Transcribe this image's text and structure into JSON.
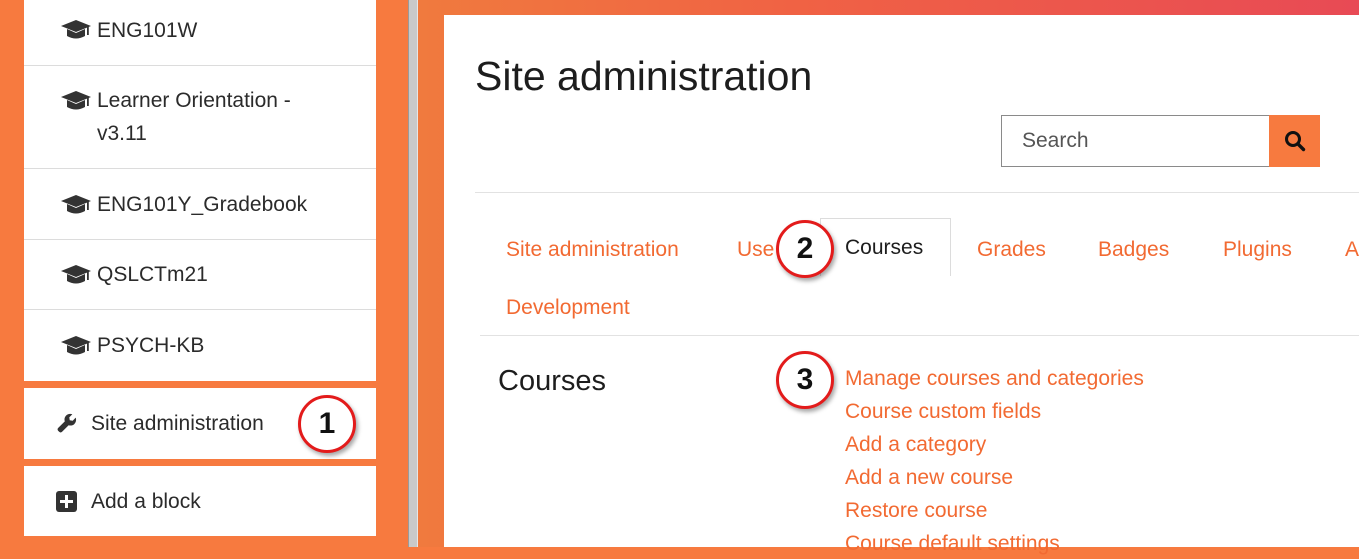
{
  "sidebar": {
    "courses": [
      {
        "label": "ENG101W"
      },
      {
        "label": "Learner Orientation -"
      },
      {
        "label": "v3.11"
      },
      {
        "label": "ENG101Y_Gradebook"
      },
      {
        "label": "QSLCTm21"
      },
      {
        "label": "PSYCH-KB"
      }
    ],
    "site_admin_label": "Site administration",
    "add_block_label": "Add a block"
  },
  "main": {
    "title": "Site administration",
    "search": {
      "placeholder": "Search"
    },
    "tabs": [
      {
        "label": "Site administration"
      },
      {
        "label": "Use"
      },
      {
        "label": "Courses",
        "active": true
      },
      {
        "label": "Grades"
      },
      {
        "label": "Badges"
      },
      {
        "label": "Plugins"
      },
      {
        "label": "A"
      },
      {
        "label": "Development"
      }
    ],
    "section": {
      "title": "Courses",
      "links": [
        {
          "label": "Manage courses and categories"
        },
        {
          "label": "Course custom fields"
        },
        {
          "label": "Add a category"
        },
        {
          "label": "Add a new course"
        },
        {
          "label": "Restore course"
        },
        {
          "label": "Course default settings"
        }
      ]
    }
  },
  "callouts": [
    "1",
    "2",
    "3"
  ],
  "colors": {
    "accent": "#f77a3f",
    "link": "#f26a32",
    "callout_border": "#e31b1b"
  },
  "icons": {
    "course": "graduation-cap-icon",
    "admin": "wrench-icon",
    "add": "plus-square-icon",
    "search": "search-icon"
  }
}
